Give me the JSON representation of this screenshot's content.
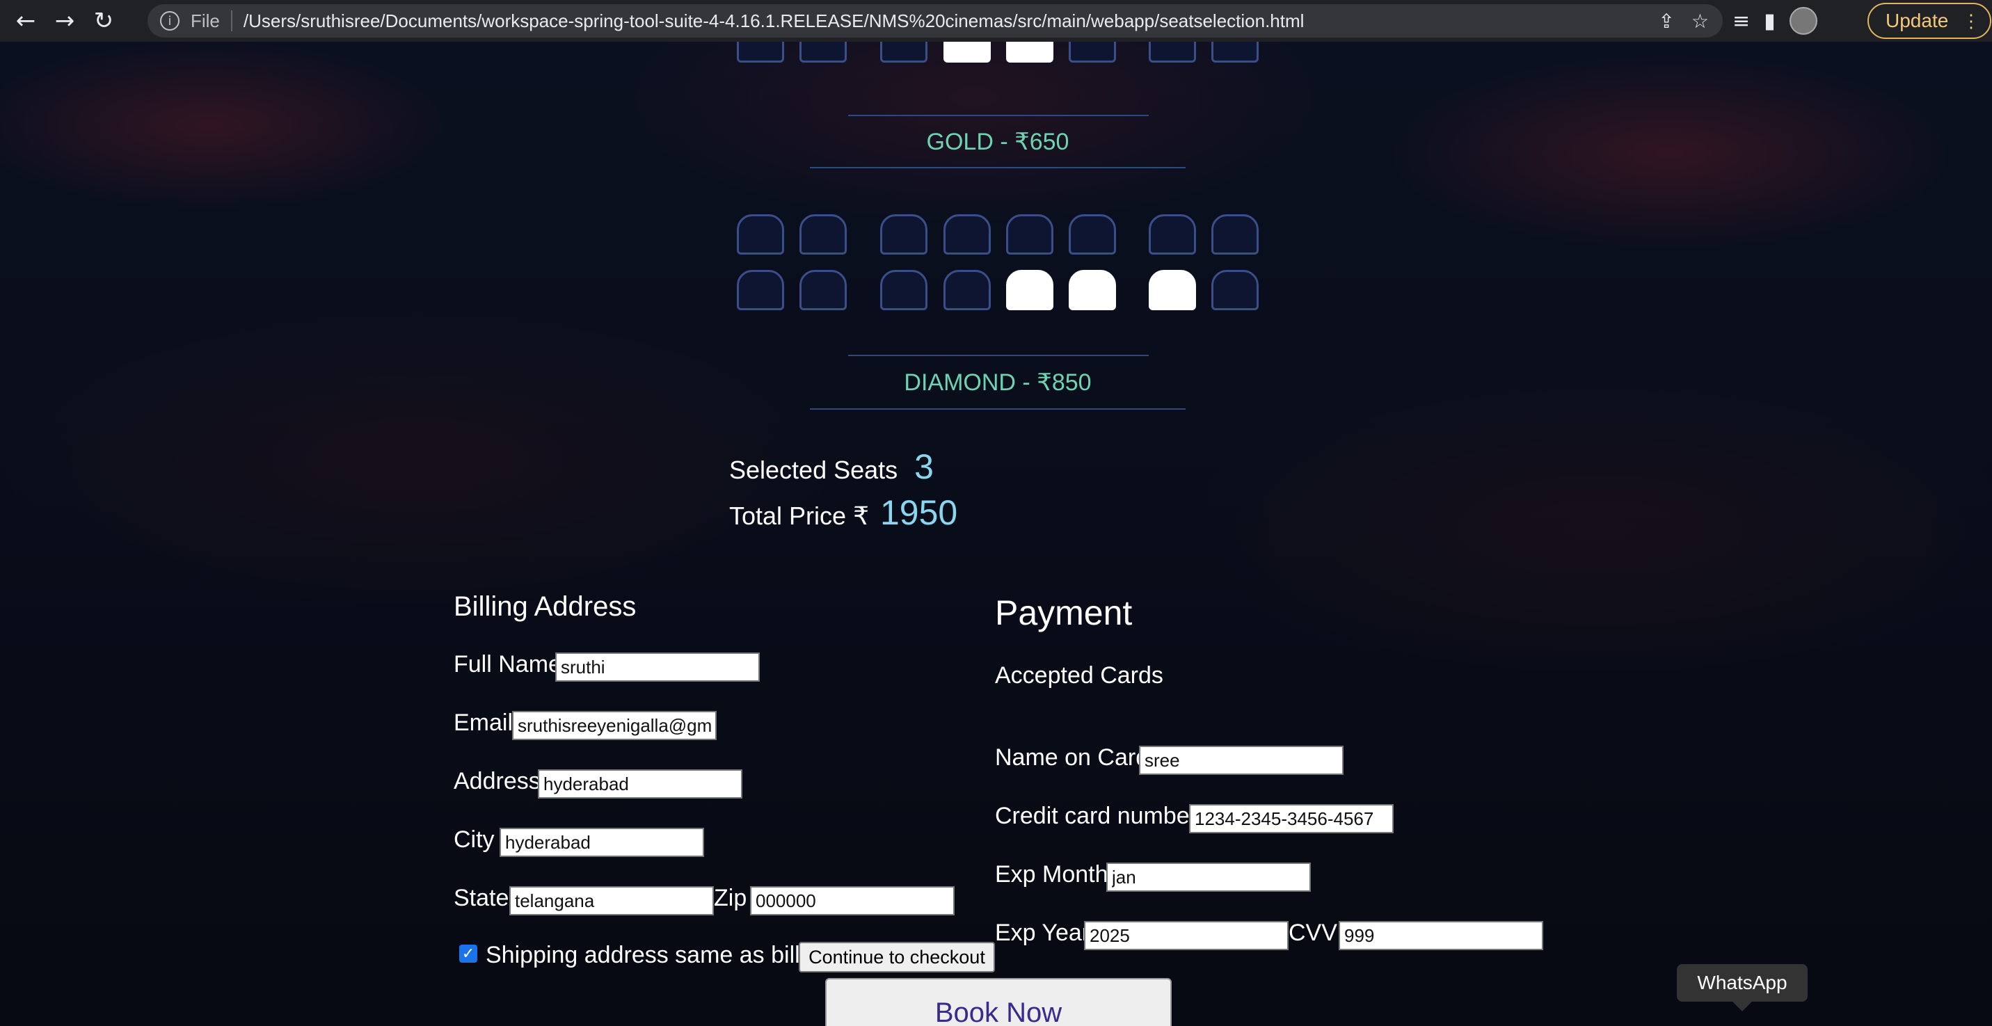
{
  "browser": {
    "scheme": "File",
    "url": "/Users/sruthisree/Documents/workspace-spring-tool-suite-4-4.16.1.RELEASE/NMS%20cinemas/src/main/webapp/seatselection.html",
    "update_label": "Update"
  },
  "tiers": {
    "gold": "GOLD - ₹650",
    "diamond": "DIAMOND - ₹850"
  },
  "summary": {
    "seats_label": "Selected Seats",
    "seats_value": "3",
    "price_label": "Total Price ₹",
    "price_value": "1950"
  },
  "billing": {
    "heading": "Billing Address",
    "full_name_label": "Full Name",
    "full_name_value": "sruthi",
    "email_label": "Email",
    "email_value": "sruthisreeyenigalla@gm",
    "address_label": "Address",
    "address_value": "hyderabad",
    "city_label": "City",
    "city_value": "hyderabad",
    "state_label": "State",
    "state_value": "telangana",
    "zip_label": "Zip",
    "zip_value": "000000",
    "same_label": "Shipping address same as billing",
    "continue_label": "Continue to checkout"
  },
  "payment": {
    "heading": "Payment",
    "accepted_label": "Accepted Cards",
    "name_label": "Name on Card",
    "name_value": "sree",
    "cc_label": "Credit card number",
    "cc_value": "1234-2345-3456-4567",
    "exp_month_label": "Exp Month",
    "exp_month_value": "jan",
    "exp_year_label": "Exp Year",
    "exp_year_value": "2025",
    "cvv_label": "CVV",
    "cvv_value": "999"
  },
  "book_label": "Book Now",
  "whatsapp_tooltip": "WhatsApp"
}
